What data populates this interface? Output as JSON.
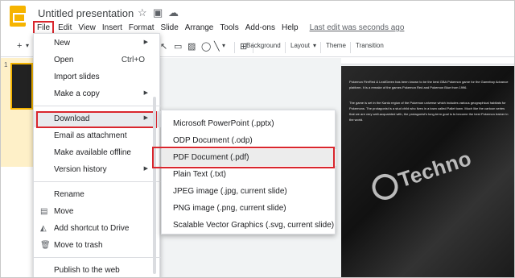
{
  "app": {
    "title": "Untitled presentation",
    "title_icons": [
      "star-icon",
      "folder-move-icon",
      "cloud-status-icon"
    ],
    "last_edit": "Last edit was seconds ago"
  },
  "menubar": [
    "File",
    "Edit",
    "View",
    "Insert",
    "Format",
    "Slide",
    "Arrange",
    "Tools",
    "Add-ons",
    "Help"
  ],
  "toolbar": {
    "add": "+",
    "background": "Background",
    "layout": "Layout",
    "theme": "Theme",
    "transition": "Transition"
  },
  "filmstrip": {
    "slide_number": "1"
  },
  "file_menu": {
    "items": [
      {
        "label": "New",
        "submenu": true
      },
      {
        "label": "Open",
        "shortcut": "Ctrl+O"
      },
      {
        "label": "Import slides"
      },
      {
        "label": "Make a copy",
        "submenu": true
      },
      {
        "label": "Download",
        "submenu": true,
        "active": true
      },
      {
        "label": "Email as attachment"
      },
      {
        "label": "Make available offline"
      },
      {
        "label": "Version history",
        "submenu": true
      },
      {
        "label": "Rename"
      },
      {
        "label": "Move",
        "icon": "folder-icon"
      },
      {
        "label": "Add shortcut to Drive",
        "icon": "drive-shortcut-icon"
      },
      {
        "label": "Move to trash",
        "icon": "trash-icon"
      },
      {
        "label": "Publish to the web"
      }
    ]
  },
  "download_menu": {
    "items": [
      {
        "label": "Microsoft PowerPoint (.pptx)"
      },
      {
        "label": "ODP Document (.odp)"
      },
      {
        "label": "PDF Document (.pdf)",
        "highlighted": true
      },
      {
        "label": "Plain Text (.txt)"
      },
      {
        "label": "JPEG image (.jpg, current slide)"
      },
      {
        "label": "PNG image (.png, current slide)"
      },
      {
        "label": "Scalable Vector Graphics (.svg, current slide)"
      }
    ]
  },
  "slide": {
    "paragraph1": "Pokemon FireRed & LeafGreen has been known to be the best GBA Pokemon game for the Gameboy Advance platform. It is a remake of the games Pokemon Red and Pokemon Blue from 1996.",
    "paragraph2": "The game is set in the Kanto region of the Pokemon universe which includes various geographical habitats for Pokemons. The protagonist is a stud child who lives in a town called Pallet town. Much like the cartoon series that we are very well-acquainted with, the protagonist's long-term goal is to become the best Pokemon trainer in the world.",
    "watermark": "Techno"
  },
  "colors": {
    "highlight_box": "#d9262d",
    "slides_logo": "#f6b400",
    "menu_hover": "#e8eaed"
  }
}
